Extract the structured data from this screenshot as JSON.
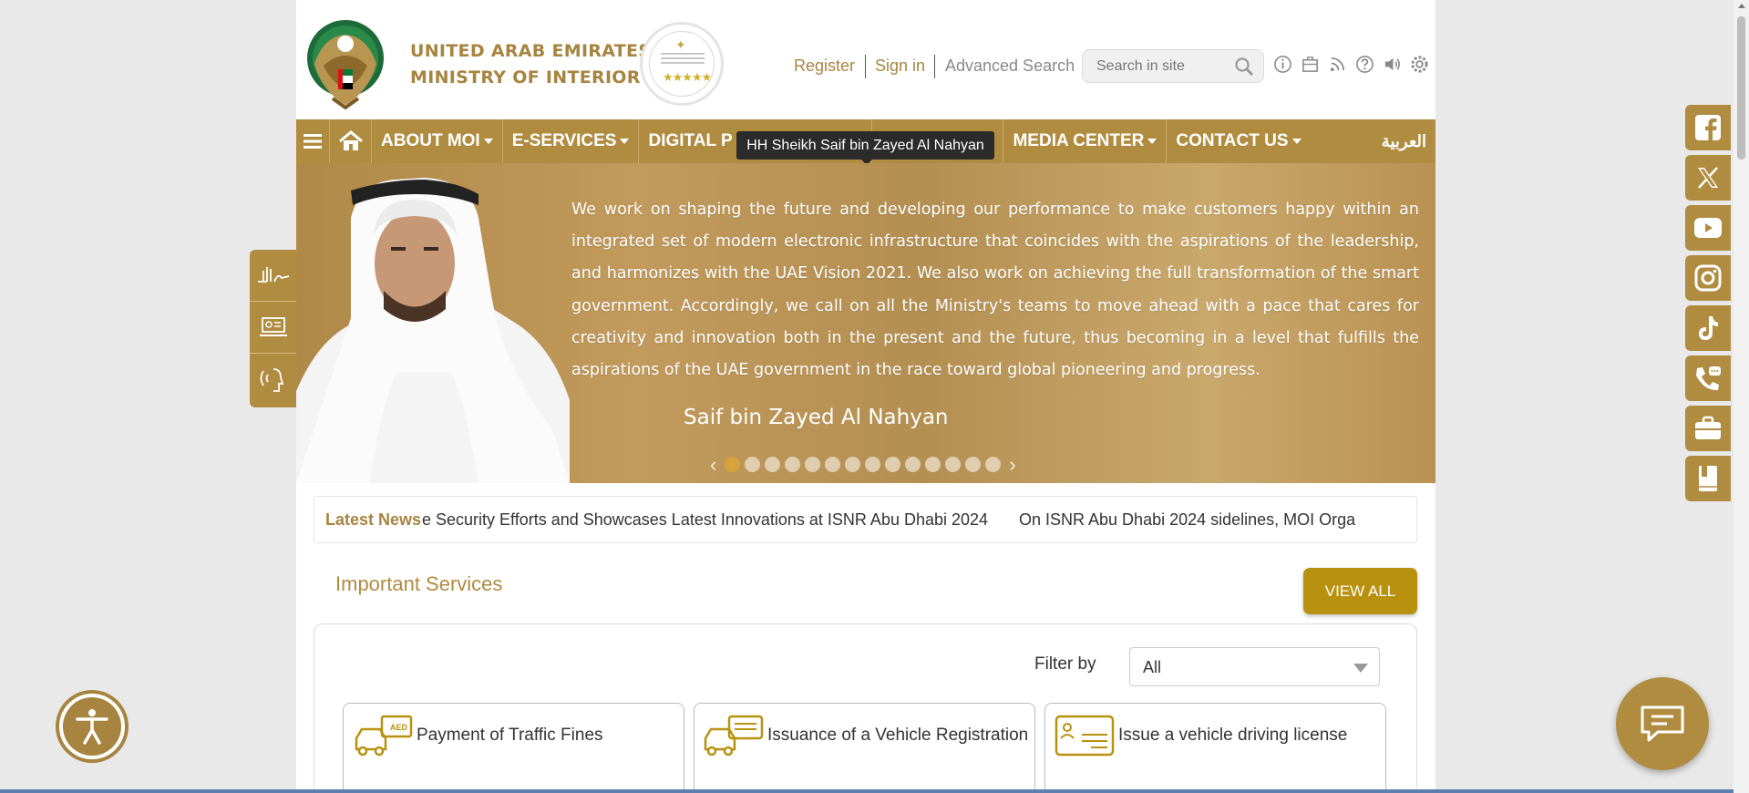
{
  "header": {
    "brand_line1": "UNITED ARAB EMIRATES",
    "brand_line2": "MINISTRY OF INTERIOR",
    "links": {
      "register": "Register",
      "sign_in": "Sign in",
      "advanced_search": "Advanced Search"
    },
    "search": {
      "placeholder": "Search in site"
    },
    "tool_icons": [
      "info-icon",
      "sitemap-icon",
      "rss-icon",
      "help-icon",
      "speaker-icon",
      "settings-icon"
    ]
  },
  "nav": {
    "items": [
      "ABOUT MOI",
      "E-SERVICES",
      "DIGITAL P",
      "",
      "MEDIA CENTER",
      "CONTACT US"
    ],
    "language": "العربية",
    "tooltip": "HH Sheikh Saif bin Zayed Al Nahyan"
  },
  "hero": {
    "quote": "We work on shaping the future and developing our performance to make customers happy within an integrated set of modern electronic infrastructure that coincides with the aspirations of the leadership, and harmonizes with the UAE Vision 2021. We also work on achieving the full transformation of the smart government. Accordingly, we call on all the Ministry's  teams to move ahead with a pace that cares for creativity and innovation both in the present and the future, thus becoming in a level that fulfills the aspirations of the UAE government in the race toward global pioneering and progress.",
    "signature": "Saif bin Zayed Al Nahyan",
    "slide_count": 14,
    "active_slide": 1
  },
  "news": {
    "label": "Latest News",
    "headline1": "e Security Efforts and Showcases Latest Innovations at ISNR Abu Dhabi 2024",
    "headline2": "On ISNR Abu Dhabi 2024 sidelines, MOI Orga"
  },
  "services": {
    "title": "Important Services",
    "view_all": "VIEW ALL",
    "filter_label": "Filter by",
    "filter_value": "All",
    "cards": [
      "Payment of Traffic Fines",
      "Issuance of a Vehicle Registration",
      "Issue a vehicle driving license"
    ]
  },
  "side_social": [
    "facebook-icon",
    "x-icon",
    "youtube-icon",
    "instagram-icon",
    "tiktok-icon",
    "call-icon",
    "briefcase-icon",
    "book-icon"
  ],
  "side_tools": [
    "sign-language-icon",
    "screen-reader-icon",
    "voice-icon"
  ],
  "colors": {
    "gold": "#b08c40",
    "brand_text": "#a7843f",
    "button": "#b8920f"
  }
}
